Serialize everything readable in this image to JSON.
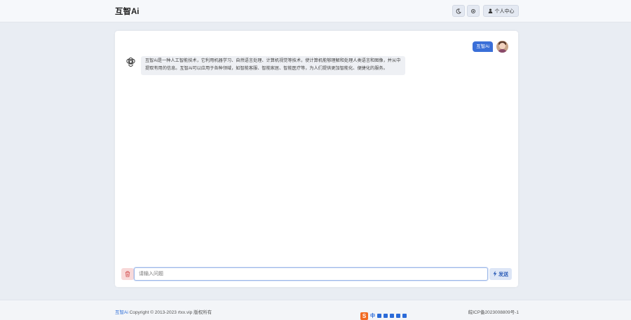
{
  "header": {
    "brand": "互智Ai",
    "profile_label": "个人中心",
    "theme_icon": "moon-icon",
    "settings_icon": "gear-icon",
    "profile_icon": "user-icon"
  },
  "chat": {
    "user_message": "互智Ai",
    "bot_message": "互智Ai是一种人工智能技术，它利用机器学习、自然语言处理、计算机视觉等技术，使计算机能够理解和处理人类语言和图像，并从中提取有用的信息。互智Ai可以应用于各种领域，如智能客服、智能家居、智能医疗等，为人们提供更加智能化、便捷化的服务。"
  },
  "input": {
    "placeholder": "请输入问题",
    "value": "",
    "send_label": "发送"
  },
  "footer": {
    "brand_link": "互智Ai",
    "copyright": " Copyright © 2013-2023 rtxx.vip 版权所有",
    "icp": "皖ICP备2023008809号-1",
    "ime_label": "中"
  },
  "colors": {
    "accent": "#3a6fd8",
    "page_bg": "#e9edf3",
    "danger_bg": "#f8d9d9"
  }
}
